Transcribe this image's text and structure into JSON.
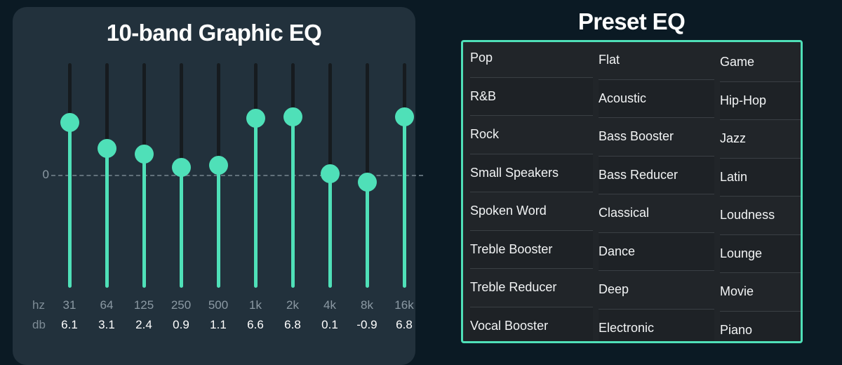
{
  "theme": {
    "page_bg": "#0b1a24",
    "card_bg": "#22313c",
    "accent": "#4fe0b8",
    "panel_bg": "#212529",
    "track_bg": "#161b1f",
    "muted_text": "#8b99a3",
    "text": "#ffffff"
  },
  "eq": {
    "title": "10-band Graphic EQ",
    "zero_label": "0",
    "hz_row_tag": "hz",
    "db_row_tag": "db",
    "bands": [
      {
        "hz": "31",
        "db": "6.1"
      },
      {
        "hz": "64",
        "db": "3.1"
      },
      {
        "hz": "125",
        "db": "2.4"
      },
      {
        "hz": "250",
        "db": "0.9"
      },
      {
        "hz": "500",
        "db": "1.1"
      },
      {
        "hz": "1k",
        "db": "6.6"
      },
      {
        "hz": "2k",
        "db": "6.8"
      },
      {
        "hz": "4k",
        "db": "0.1"
      },
      {
        "hz": "8k",
        "db": "-0.9"
      },
      {
        "hz": "16k",
        "db": "6.8"
      }
    ]
  },
  "presets": {
    "title": "Preset EQ",
    "columns": [
      {
        "items": [
          "Pop",
          "R&B",
          "Rock",
          "Small Speakers",
          "Spoken Word",
          "Treble Booster",
          "Treble Reducer",
          "Vocal Booster"
        ]
      },
      {
        "items": [
          "Flat",
          "Acoustic",
          "Bass Booster",
          "Bass Reducer",
          "Classical",
          "Dance",
          "Deep",
          "Electronic"
        ]
      },
      {
        "items": [
          "Game",
          "Hip-Hop",
          "Jazz",
          "Latin",
          "Loudness",
          "Lounge",
          "Movie",
          "Piano"
        ]
      }
    ]
  },
  "chart_data": {
    "type": "bar",
    "title": "10-band Graphic EQ",
    "xlabel": "hz",
    "ylabel": "db",
    "categories": [
      "31",
      "64",
      "125",
      "250",
      "500",
      "1k",
      "2k",
      "4k",
      "8k",
      "16k"
    ],
    "values": [
      6.1,
      3.1,
      2.4,
      0.9,
      1.1,
      6.6,
      6.8,
      0.1,
      -0.9,
      6.8
    ],
    "ylim": [
      -12,
      12
    ],
    "grid": false,
    "legend": "none",
    "annotations": [
      "0"
    ]
  }
}
